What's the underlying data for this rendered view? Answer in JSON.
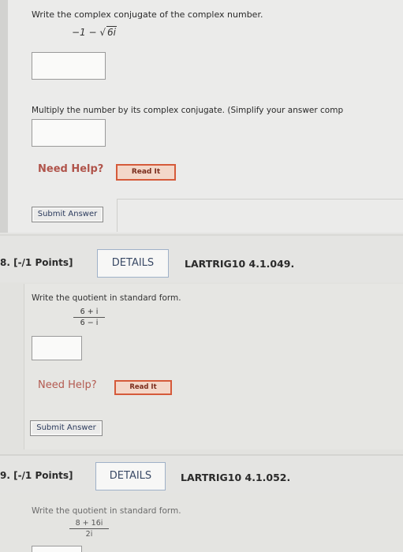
{
  "q7": {
    "prompt": "Write the complex conjugate of the complex number.",
    "expr_prefix": "−1 − ",
    "expr_radicand": "6i",
    "multiply_prompt": "Multiply the number by its complex conjugate. (Simplify your answer comp",
    "need_help": "Need Help?",
    "read_it": "Read It",
    "submit": "Submit Answer"
  },
  "q8": {
    "label": "8. [-/1 Points]",
    "details": "DETAILS",
    "code": "LARTRIG10 4.1.049.",
    "prompt": "Write the quotient in standard form.",
    "numerator": "6 + i",
    "denominator": "6 − i",
    "need_help": "Need Help?",
    "read_it": "Read It",
    "submit": "Submit Answer"
  },
  "q9": {
    "label": "9. [-/1 Points]",
    "details": "DETAILS",
    "code": "LARTRIG10 4.1.052.",
    "prompt": "Write the quotient in standard form.",
    "numerator": "8 + 16i",
    "denominator": "2i"
  },
  "colors": {
    "need_help": "#b0544b",
    "read_it_border": "#d55a3a",
    "details_border": "#9fb1c8"
  }
}
